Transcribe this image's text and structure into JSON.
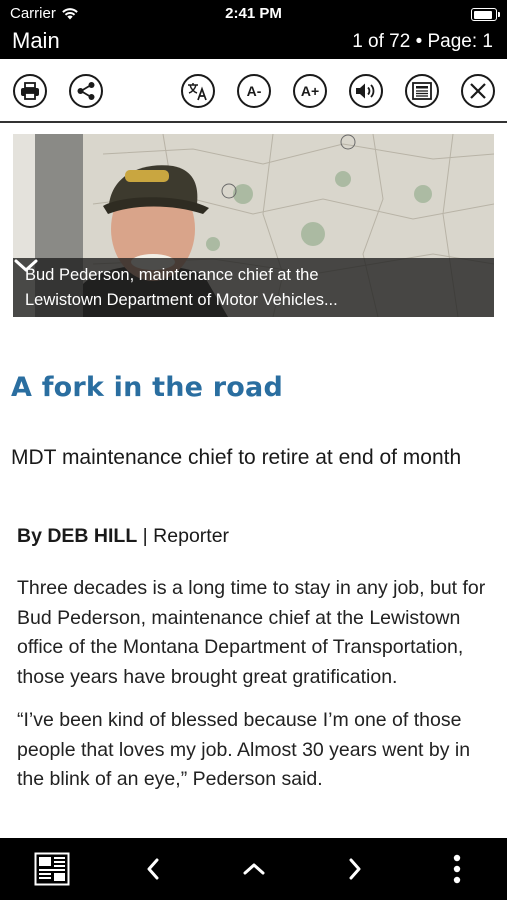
{
  "status_bar": {
    "carrier": "Carrier",
    "time": "2:41 PM",
    "battery_level": 1.0
  },
  "nav": {
    "title": "Main",
    "counter": "1 of 72 • Page: 1"
  },
  "toolbar": {
    "buttons": [
      {
        "name": "print",
        "icon": "printer-icon"
      },
      {
        "name": "share",
        "icon": "share-icon"
      },
      {
        "name": "translate",
        "icon": "translate-icon"
      },
      {
        "name": "decrease-font",
        "label": "A-"
      },
      {
        "name": "increase-font",
        "label": "A+"
      },
      {
        "name": "read-aloud",
        "icon": "speaker-icon"
      },
      {
        "name": "text-view",
        "icon": "article-view-icon"
      },
      {
        "name": "close",
        "icon": "close-icon"
      }
    ]
  },
  "photo": {
    "caption": "Bud Pederson, maintenance chief at the\nLewistown Department of Motor Vehicles...",
    "chevron_icon": "chevron-down-icon"
  },
  "article": {
    "headline": "A fork in the road",
    "subhead": "MDT maintenance chief to retire at end of month",
    "byline_author": "By DEB HILL",
    "byline_sep": " | ",
    "byline_role": "Reporter",
    "paragraphs": [
      "Three decades is a long time to stay in any job, but for Bud Pederson, maintenance chief at the Lewistown office of the Montana Department of Transportation, those years have brought great gratification.",
      "“I’ve been kind of blessed because I’m one of those people that loves my job. Almost 30 years went by in the blink of an eye,” Pederson said."
    ]
  },
  "colors": {
    "headline": "#2a6ea0",
    "bars": "#000000",
    "caption_bg": "#1e1e1e"
  },
  "bottom_bar": {
    "icons": [
      "newspaper-icon",
      "chevron-left-icon",
      "chevron-up-icon",
      "chevron-right-icon",
      "more-vertical-icon"
    ]
  }
}
